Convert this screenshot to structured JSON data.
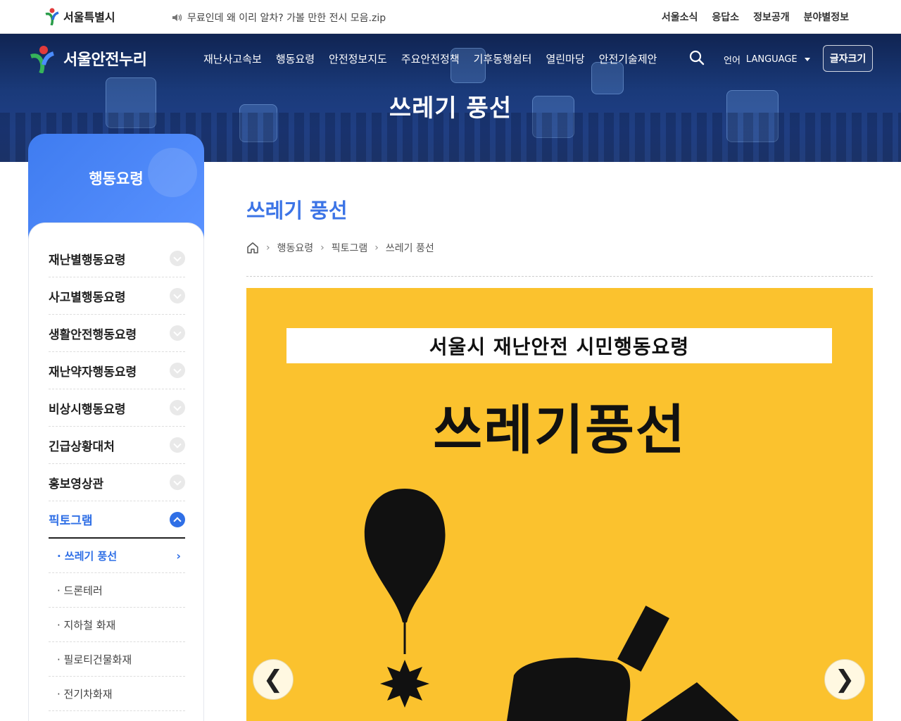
{
  "topbar": {
    "city_logo_text": "서울특별시",
    "notice_text": "무료인데 왜 이리 알차? 가볼 만한 전시 모음.zip",
    "links": [
      "서울소식",
      "응답소",
      "정보공개",
      "분야별정보"
    ]
  },
  "header": {
    "site_name": "서울안전누리",
    "gnb": [
      "재난사고속보",
      "행동요령",
      "안전정보지도",
      "주요안전정책",
      "기후동행쉼터",
      "열린마당",
      "안전기술제안"
    ],
    "lang_label": "언어",
    "lang_value": "LANGUAGE",
    "font_size_button": "글자크기",
    "hero_title": "쓰레기 풍선"
  },
  "sidebar": {
    "title": "행동요령",
    "items": [
      {
        "label": "재난별행동요령"
      },
      {
        "label": "사고별행동요령"
      },
      {
        "label": "생활안전행동요령"
      },
      {
        "label": "재난약자행동요령"
      },
      {
        "label": "비상시행동요령"
      },
      {
        "label": "긴급상황대처"
      },
      {
        "label": "홍보영상관"
      },
      {
        "label": "픽토그램"
      }
    ],
    "sub_items": [
      {
        "label": "· 쓰레기 풍선"
      },
      {
        "label": "· 드론테러"
      },
      {
        "label": "· 지하철 화재"
      },
      {
        "label": "· 필로티건물화재"
      },
      {
        "label": "· 전기차화재"
      }
    ]
  },
  "main": {
    "page_title": "쓰레기 풍선",
    "breadcrumb": [
      "행동요령",
      "픽토그램",
      "쓰레기 풍선"
    ],
    "slide": {
      "banner": "서울시 재난안전 시민행동요령",
      "title": "쓰레기풍선",
      "prev": "❮",
      "next": "❯"
    }
  },
  "colors": {
    "accent": "#3c74e6",
    "slide_bg": "#fbc22e",
    "hero_bg": "#1a3a7a"
  }
}
